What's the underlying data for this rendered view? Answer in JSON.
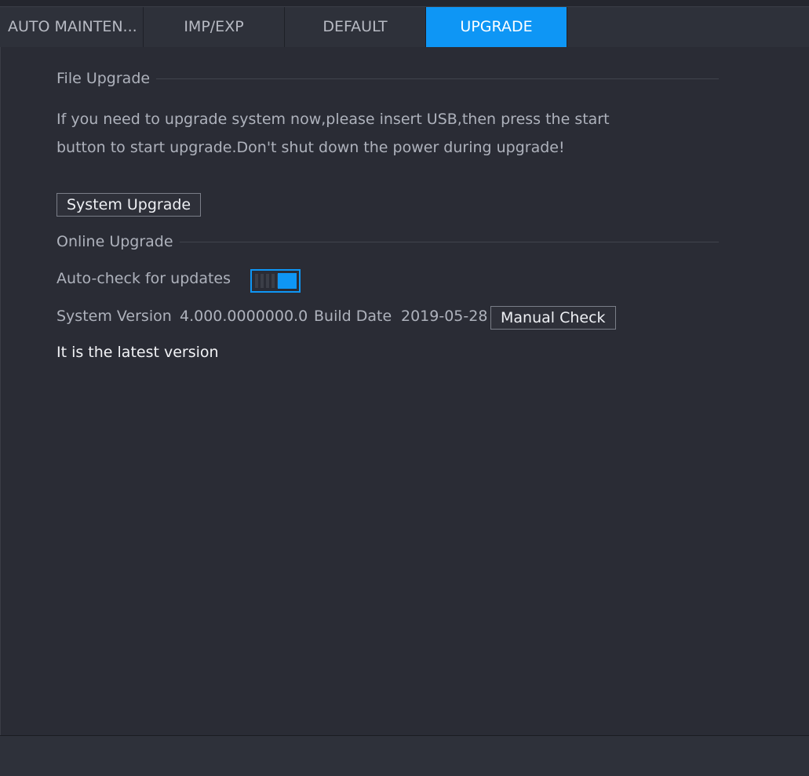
{
  "tabs": [
    {
      "label": "AUTO MAINTEN..."
    },
    {
      "label": "IMP/EXP"
    },
    {
      "label": "DEFAULT"
    },
    {
      "label": "UPGRADE"
    }
  ],
  "active_tab": "UPGRADE",
  "file_upgrade": {
    "title": "File Upgrade",
    "line1": "If you need to upgrade system now,please insert USB,then press the start",
    "line2": "button to start upgrade.Don't shut down the power during upgrade!",
    "button": "System Upgrade"
  },
  "online_upgrade": {
    "title": "Online Upgrade",
    "auto_check_label": "Auto-check for updates",
    "auto_check_enabled": true,
    "system_version_label": "System Version",
    "system_version_value": "4.000.0000000.0",
    "build_date_label": "Build Date",
    "build_date_value": "2019-05-28",
    "manual_check_button": "Manual Check",
    "status": "It is the latest version"
  },
  "colors": {
    "accent": "#0e96f5",
    "background": "#2a2c35"
  }
}
